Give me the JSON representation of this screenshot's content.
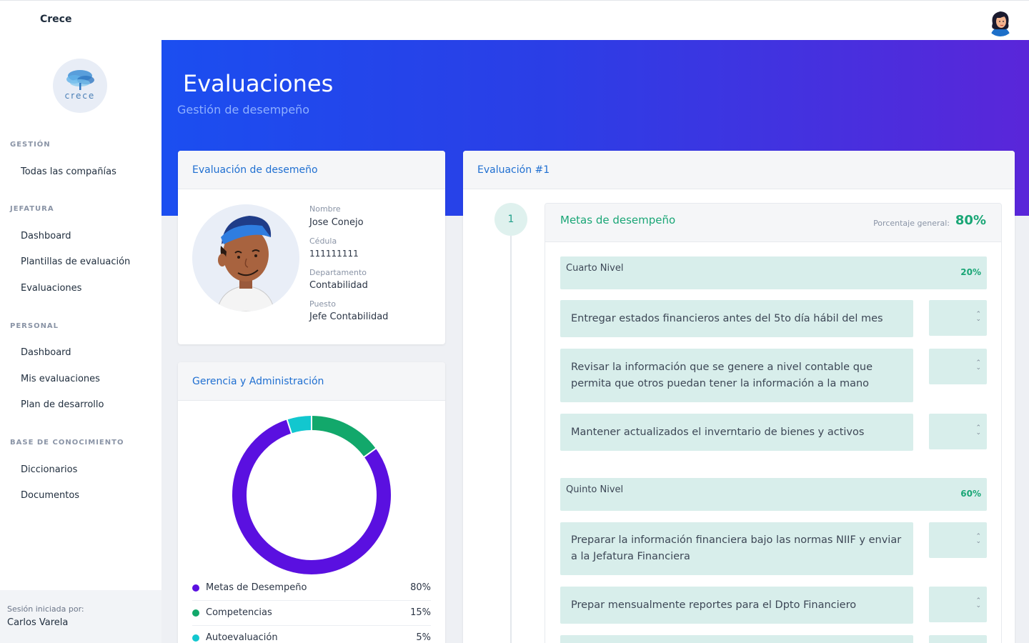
{
  "app": {
    "brand": "Crece",
    "logo_text": "crece"
  },
  "sidebar": {
    "sections": [
      {
        "title": "GESTIÓN",
        "items": [
          "Todas las compañías"
        ]
      },
      {
        "title": "JEFATURA",
        "items": [
          "Dashboard",
          "Plantillas de evaluación",
          "Evaluaciones"
        ]
      },
      {
        "title": "PERSONAL",
        "items": [
          "Dashboard",
          "Mis evaluaciones",
          "Plan de desarrollo"
        ]
      },
      {
        "title": "BASE DE CONOCIMIENTO",
        "items": [
          "Diccionarios",
          "Documentos"
        ]
      }
    ],
    "session_label": "Sesión iniciada por:",
    "session_user": "Carlos Varela"
  },
  "hero": {
    "title": "Evaluaciones",
    "subtitle": "Gestión de desempeño"
  },
  "profile_card": {
    "title": "Evaluación de desemeño",
    "fields": [
      {
        "label": "Nombre",
        "value": "Jose Conejo"
      },
      {
        "label": "Cédula",
        "value": "111111111"
      },
      {
        "label": "Departamento",
        "value": "Contabilidad"
      },
      {
        "label": "Puesto",
        "value": "Jefe Contabilidad"
      }
    ]
  },
  "chart_card": {
    "title": "Gerencia y Administración"
  },
  "chart_data": {
    "type": "pie",
    "donut": true,
    "categories": [
      "Metas de Desempeño",
      "Competencias",
      "Autoevaluación"
    ],
    "values": [
      80,
      15,
      5
    ],
    "value_labels": [
      "80%",
      "15%",
      "5%"
    ],
    "colors": [
      "#5a10e0",
      "#12a86b",
      "#12c7cf"
    ]
  },
  "evaluation": {
    "title": "Evaluación #1",
    "step": "1",
    "goals_title": "Metas de desempeño",
    "overall_label": "Porcentaje general:",
    "overall_value": "80%",
    "levels": [
      {
        "name": "Cuarto Nivel",
        "pct": "20%",
        "goals": [
          "Entregar estados financieros antes del 5to día hábil del mes",
          "Revisar la información que se genere a nivel contable que permita que otros puedan tener la información a la mano",
          "Mantener actualizados el inverntario de bienes y activos"
        ]
      },
      {
        "name": "Quinto Nivel",
        "pct": "60%",
        "goals": [
          "Preparar la información financiera bajo las normas NIIF y enviar a la Jefatura Financiera",
          "Prepar mensualmente reportes para el Dpto Financiero"
        ]
      }
    ]
  }
}
